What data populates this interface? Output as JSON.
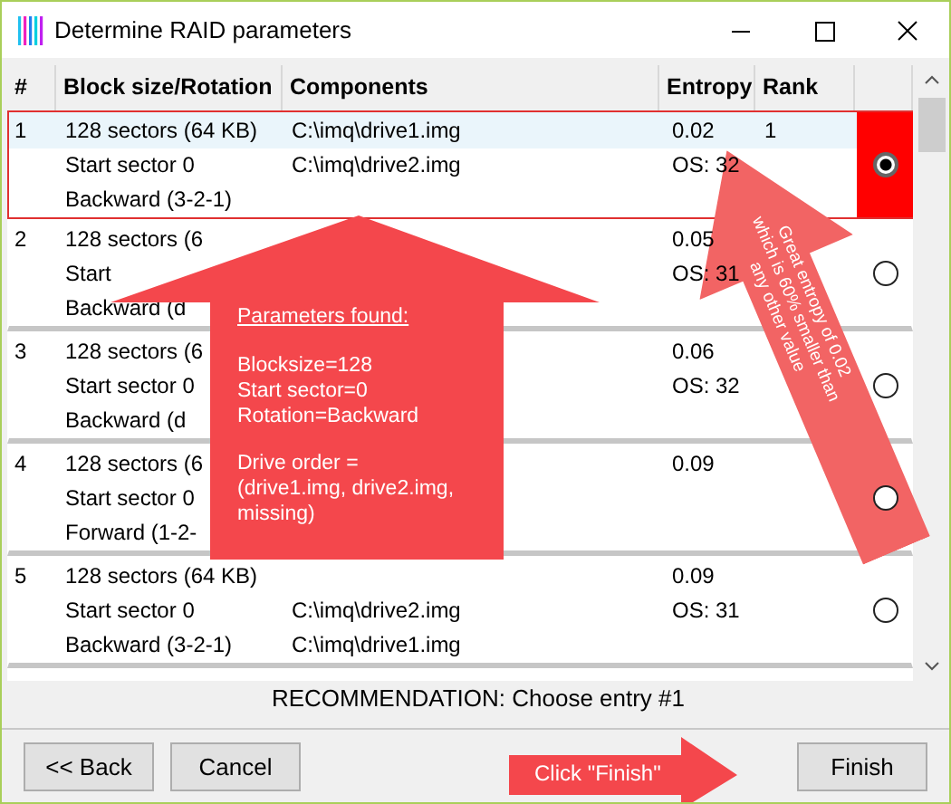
{
  "window": {
    "title": "Determine RAID parameters"
  },
  "table": {
    "columns": [
      "#",
      "Block size/Rotation",
      "Components",
      "Entropy",
      "Rank"
    ],
    "rows": [
      {
        "number": "1",
        "block": [
          "128 sectors (64 KB)",
          "Start sector 0",
          "Backward (3-2-1)"
        ],
        "components": [
          "C:\\imq\\drive1.img",
          "C:\\imq\\drive2.img"
        ],
        "skip_first_line": false,
        "entropy": [
          "0.02",
          "OS: 32"
        ],
        "rank": "1",
        "selected": true
      },
      {
        "number": "2",
        "block": [
          "128 sectors (6",
          "Start",
          "Backward (d"
        ],
        "entropy": [
          "0.05",
          "OS: 31"
        ],
        "selected": false
      },
      {
        "number": "3",
        "block": [
          "128 sectors (6",
          "Start sector 0",
          "Backward (d"
        ],
        "entropy": [
          "0.06",
          "OS: 32"
        ],
        "selected": false
      },
      {
        "number": "4",
        "block": [
          "128 sectors (6",
          "Start sector 0",
          "Forward (1-2-"
        ],
        "entropy": [
          "0.09"
        ],
        "selected": false
      },
      {
        "number": "5",
        "block": [
          "128 sectors (64 KB)",
          "Start sector 0",
          "Backward (3-2-1)"
        ],
        "components": [
          "C:\\imq\\drive2.img",
          "C:\\imq\\drive1.img"
        ],
        "skip_first_line": true,
        "entropy": [
          "0.09",
          "OS: 31"
        ],
        "selected": false
      }
    ]
  },
  "recommendation": "RECOMMENDATION: Choose entry #1",
  "buttons": [
    {
      "label": "<< Back",
      "kind": "navigation"
    },
    {
      "label": "Cancel",
      "kind": "navigation"
    },
    {
      "label": "Finish",
      "kind": "finish"
    }
  ],
  "annotations": [
    {
      "kind": "up-arrow",
      "title": "Parameters found:",
      "paragraphs": [
        "Blocksize=128\nStart sector=0\nRotation=Backward",
        "Drive order =\n(drive1.img, drive2.img,\nmissing)"
      ]
    },
    {
      "kind": "diagonal-arrow",
      "text": "Great entropy of 0.02 which is 60% smaller than any other value"
    },
    {
      "kind": "right-arrow",
      "text": "Click \"Finish\""
    }
  ]
}
